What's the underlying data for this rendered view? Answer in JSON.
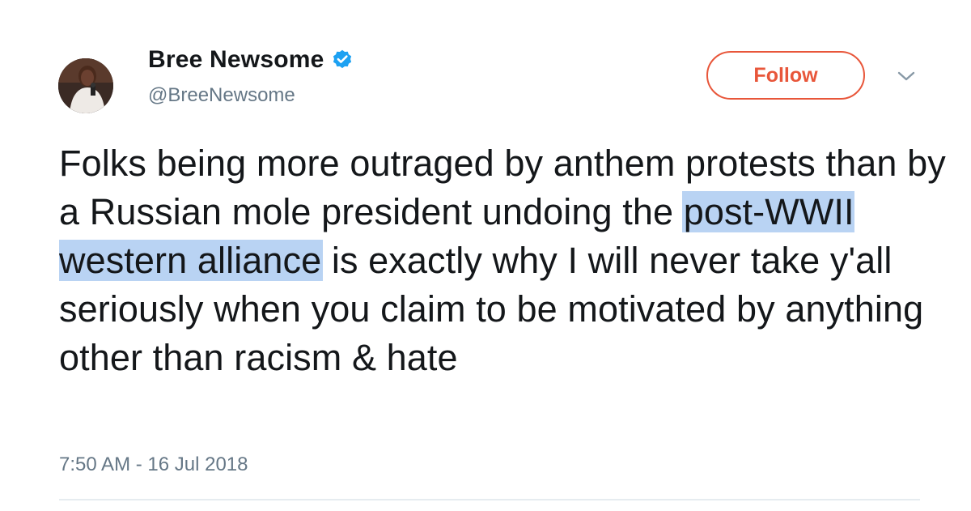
{
  "author": {
    "display_name": "Bree Newsome",
    "handle": "@BreeNewsome",
    "verified": true
  },
  "actions": {
    "follow_label": "Follow",
    "menu_icon": "chevron-down-icon"
  },
  "tweet": {
    "text_before_highlight": "Folks being more outraged by anthem protests than by a Russian mole president undoing the ",
    "text_highlighted": "post-WWII western alliance",
    "text_after_highlight": " is exactly why I will never take y'all seriously when you claim to be motivated by anything other than racism & hate",
    "timestamp": "7:50 AM - 16 Jul 2018"
  },
  "colors": {
    "follow_accent": "#e8563a",
    "verified_badge": "#1da1f2",
    "highlight": "#b9d3f3",
    "secondary_text": "#657786"
  }
}
